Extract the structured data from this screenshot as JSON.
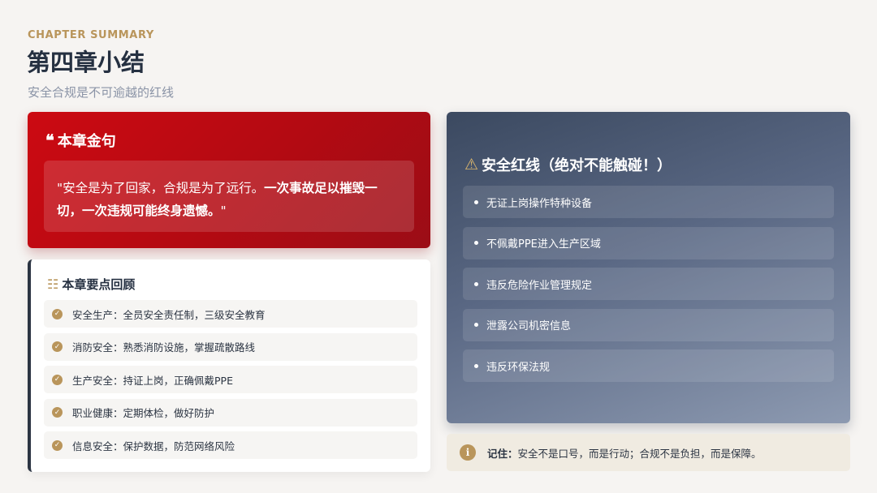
{
  "header": {
    "kicker": "CHAPTER SUMMARY",
    "title": "第四章小结",
    "subtitle": "安全合规是不可逾越的红线"
  },
  "quote": {
    "icon": "quote-icon",
    "heading": "本章金句",
    "text_normal": "\"安全是为了回家，合规是为了远行。",
    "text_bold": "一次事故足以摧毁一切，一次违规可能终身遗憾。",
    "text_end": "\""
  },
  "review": {
    "icon": "list-check-icon",
    "heading": "本章要点回顾",
    "items": [
      "安全生产：全员安全责任制，三级安全教育",
      "消防安全：熟悉消防设施，掌握疏散路线",
      "生产安全：持证上岗，正确佩戴PPE",
      "职业健康：定期体检，做好防护",
      "信息安全：保护数据，防范网络风险"
    ]
  },
  "redline": {
    "icon": "warning-icon",
    "heading": "安全红线（绝对不能触碰！）",
    "items": [
      "无证上岗操作特种设备",
      "不佩戴PPE进入生产区域",
      "违反危险作业管理规定",
      "泄露公司机密信息",
      "违反环保法规"
    ]
  },
  "remember": {
    "icon": "info-icon",
    "label": "记住：",
    "text": "安全不是口号，而是行动；合规不是负担，而是保障。"
  },
  "colors": {
    "accent_gold": "#b9955b",
    "quote_red": "#c40a12",
    "slate": "#5a6884",
    "title": "#253041"
  }
}
